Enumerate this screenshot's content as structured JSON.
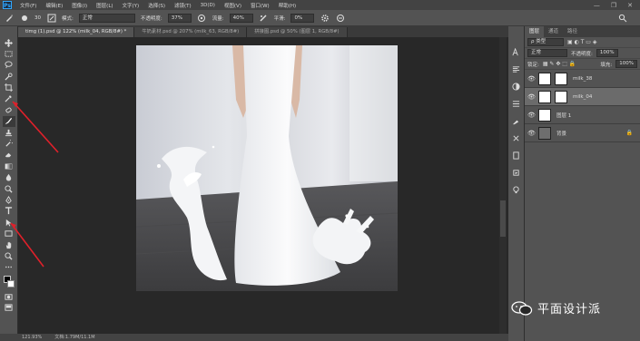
{
  "menu": {
    "logo": "Ps",
    "items": [
      "文件(F)",
      "编辑(E)",
      "图像(I)",
      "图层(L)",
      "文字(Y)",
      "选择(S)",
      "滤镜(T)",
      "3D(D)",
      "视图(V)",
      "窗口(W)",
      "帮助(H)"
    ],
    "window_controls": [
      "—",
      "❐",
      "✕"
    ]
  },
  "options": {
    "brush_size": "30",
    "mode_label": "模式:",
    "mode_value": "正常",
    "opacity_label": "不透明度:",
    "opacity_value": "37%",
    "flow_label": "流量:",
    "flow_value": "40%",
    "smooth_label": "平滑:",
    "smooth_value": "0%"
  },
  "tabs": [
    "timg (1).psd @ 122% (milk_04, RGB/8#) *",
    "牛奶素材.psd @ 207% (milk_63, RGB/8#)",
    "拼接图.psd @ 50% (图层 1, RGB/8#)"
  ],
  "panel": {
    "tabs": [
      "图层",
      "通道",
      "路径"
    ],
    "kind_label": "ρ 类型",
    "blend_mode": "正常",
    "opacity_label": "不透明度:",
    "opacity_value": "100%",
    "lock_label": "锁定:",
    "fill_label": "填充:",
    "fill_value": "100%",
    "layers": [
      {
        "name": "milk_38",
        "thumb": "light",
        "selected": false,
        "lock": ""
      },
      {
        "name": "milk_04",
        "thumb": "light",
        "selected": true,
        "lock": ""
      },
      {
        "name": "图层 1",
        "thumb": "light",
        "selected": false,
        "lock": ""
      },
      {
        "name": "背景",
        "thumb": "dark",
        "selected": false,
        "lock": "🔒"
      }
    ]
  },
  "status": {
    "zoom": "121.93%",
    "doc": "文档:1.79M/11.1M"
  },
  "watermark": {
    "text": "平面设计派"
  },
  "colors": {
    "accent_red": "#e0202a",
    "brand_blue": "#31a8ff"
  }
}
